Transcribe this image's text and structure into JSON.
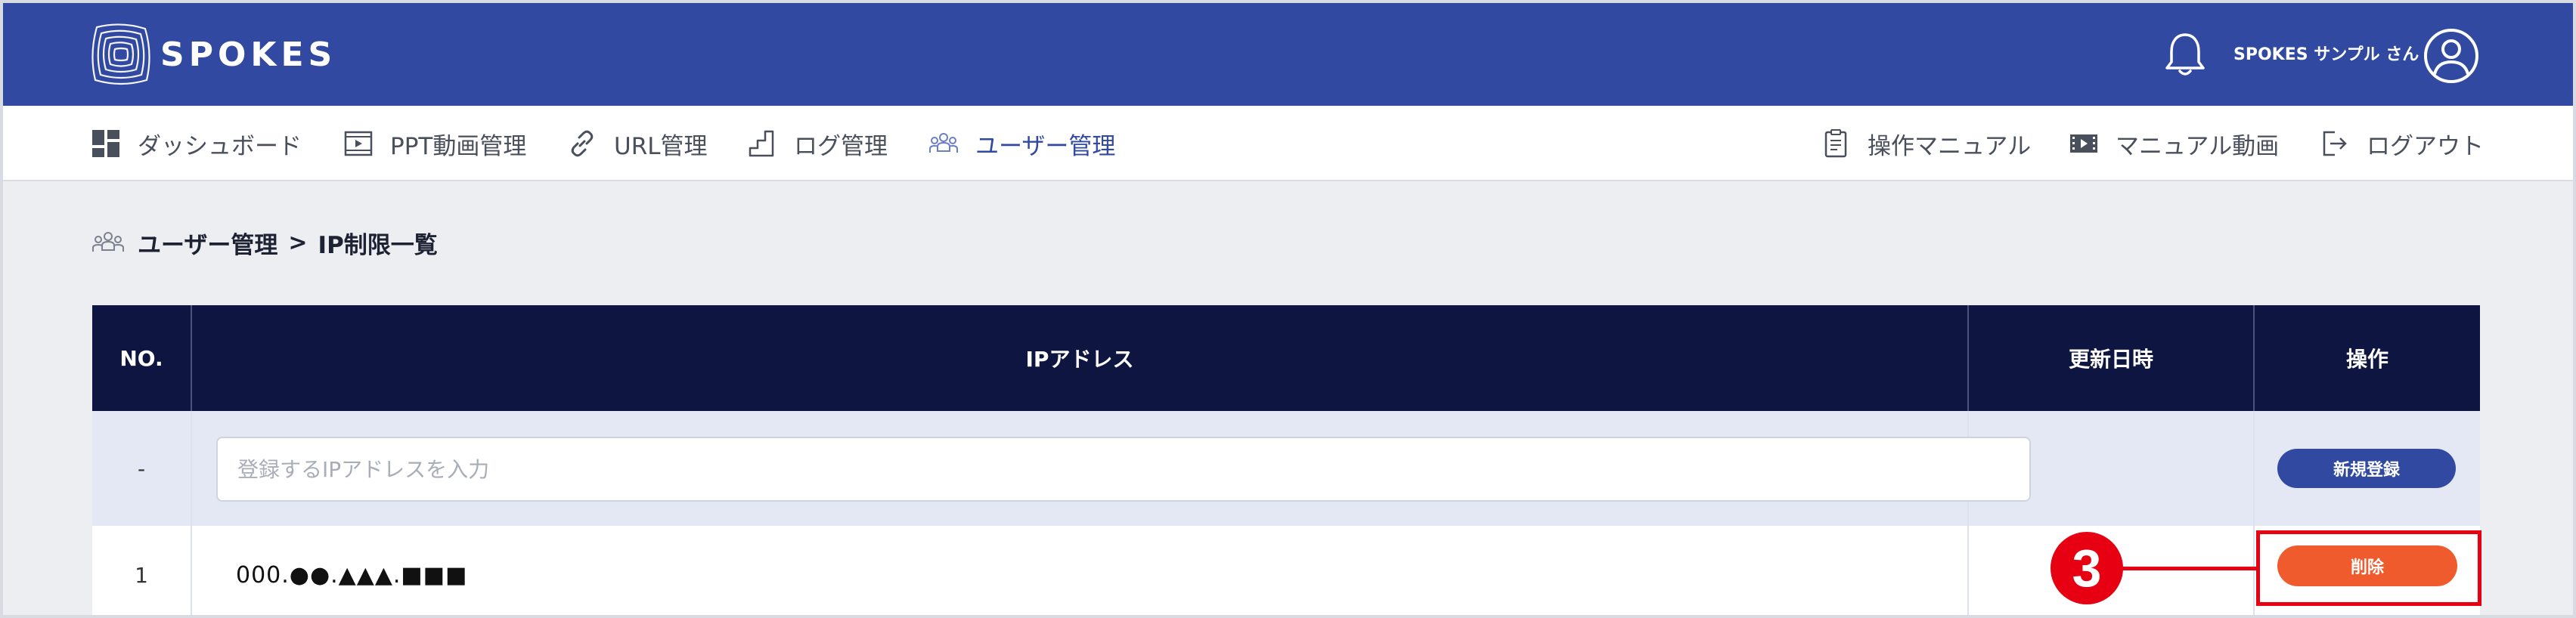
{
  "header": {
    "logo_text": "SPOKES",
    "user_name": "SPOKES サンプル  さん",
    "brand_color": "#3149a0"
  },
  "nav": {
    "left": [
      {
        "label": "ダッシュボード",
        "icon": "dashboard-icon"
      },
      {
        "label": "PPT動画管理",
        "icon": "ppt-video-icon"
      },
      {
        "label": "URL管理",
        "icon": "link-icon"
      },
      {
        "label": "ログ管理",
        "icon": "log-icon"
      },
      {
        "label": "ユーザー管理",
        "icon": "users-icon",
        "active": true
      }
    ],
    "right": [
      {
        "label": "操作マニュアル",
        "icon": "manual-icon"
      },
      {
        "label": "マニュアル動画",
        "icon": "film-icon"
      },
      {
        "label": "ログアウト",
        "icon": "logout-icon"
      }
    ]
  },
  "breadcrumb": {
    "parent": "ユーザー管理",
    "separator": ">",
    "current": "IP制限一覧"
  },
  "table": {
    "columns": [
      "NO.",
      "IPアドレス",
      "更新日時",
      "操作"
    ],
    "input_row": {
      "no": "-",
      "placeholder": "登録するIPアドレスを入力",
      "value": "",
      "updated": "",
      "action_label": "新規登録"
    },
    "rows": [
      {
        "no": "1",
        "ip": "000.●●.▲▲▲.■■■",
        "updated": "",
        "action_label": "削除"
      }
    ],
    "header_bg": "#0e1540",
    "delete_color": "#f05b2e"
  },
  "annotation": {
    "step_number": "3",
    "color": "#e60012"
  }
}
